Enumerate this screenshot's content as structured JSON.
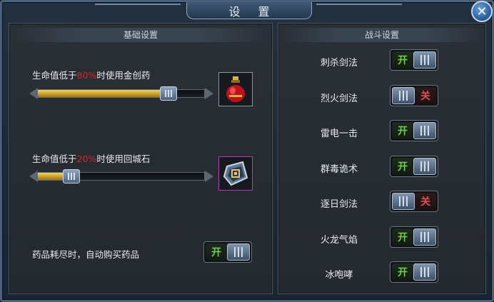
{
  "window": {
    "title": "设 置"
  },
  "close_button": {
    "glyph": "✕"
  },
  "basic": {
    "header": "基础设置",
    "hp_potion": {
      "label_prefix": "生命值低于",
      "percent": "80%",
      "label_suffix": "时使用金创药",
      "value_fraction": 0.78,
      "item_icon": "red-potion-icon"
    },
    "hp_return": {
      "label_prefix": "生命值低于",
      "percent": "20%",
      "label_suffix": "时使用回城石",
      "value_fraction": 0.2,
      "item_icon": "return-stone-icon"
    },
    "auto_buy": {
      "label": "药品耗尽时，自动购买药品",
      "state": "on",
      "on_text": "开"
    }
  },
  "battle": {
    "header": "战斗设置",
    "skills": [
      {
        "name": "刺杀剑法",
        "state": "on",
        "text": "开"
      },
      {
        "name": "烈火剑法",
        "state": "off",
        "text": "关"
      },
      {
        "name": "雷电一击",
        "state": "on",
        "text": "开"
      },
      {
        "name": "群毒诡术",
        "state": "on",
        "text": "开"
      },
      {
        "name": "逐日剑法",
        "state": "off",
        "text": "关"
      },
      {
        "name": "火龙气焰",
        "state": "on",
        "text": "开"
      },
      {
        "name": "冰咆哮",
        "state": "on",
        "text": "开"
      }
    ]
  },
  "colors": {
    "percent": "#e02222",
    "on": "#6dd24a",
    "off": "#e05050",
    "gold": "#d8b24a"
  }
}
